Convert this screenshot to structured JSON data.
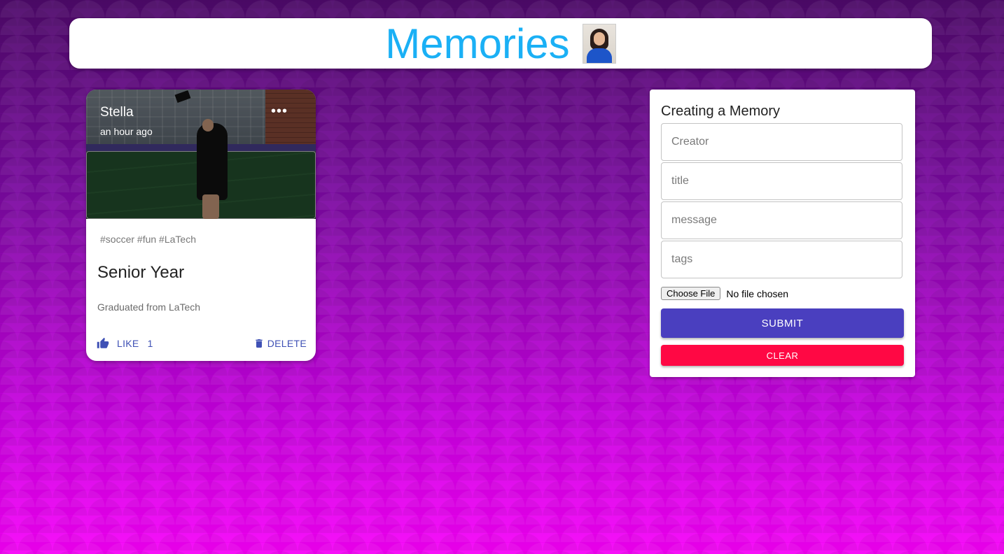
{
  "header": {
    "title": "Memories",
    "avatar_icon": "profile-photo"
  },
  "post": {
    "creator": "Stella",
    "time": "an hour ago",
    "more_icon": "more-horiz-icon",
    "more_glyph": "•••",
    "tags": "#soccer #fun #LaTech",
    "title": "Senior Year",
    "message": "Graduated from LaTech",
    "like_label": "LIKE",
    "like_count": "1",
    "delete_label": "DELETE"
  },
  "form": {
    "title": "Creating a Memory",
    "creator_placeholder": "Creator",
    "title_placeholder": "title",
    "message_placeholder": "message",
    "tags_placeholder": "tags",
    "file_button": "Choose File",
    "file_status": "No file chosen",
    "submit_label": "SUBMIT",
    "clear_label": "CLEAR"
  },
  "colors": {
    "title": "#1ab0f5",
    "primary": "#4a3fbf",
    "secondary": "#ff0844",
    "action_text": "#3f51b5"
  }
}
